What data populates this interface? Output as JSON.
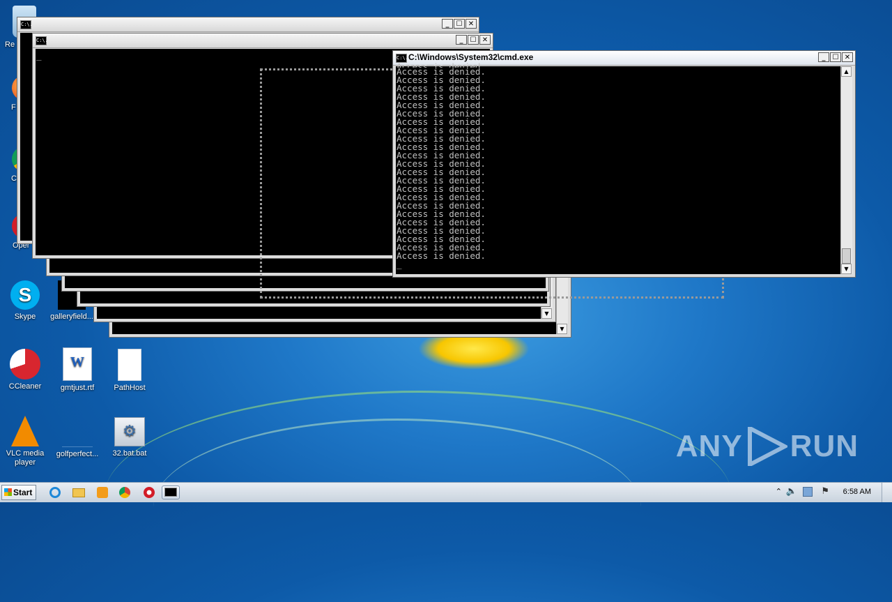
{
  "desktop": {
    "icons": [
      {
        "label": "Re"
      },
      {
        "label": "F"
      },
      {
        "label": "C"
      },
      {
        "label": "Oper"
      },
      {
        "label": "Skype"
      },
      {
        "label": "galleryfield..."
      },
      {
        "label": "CCleaner"
      },
      {
        "label": "gmtjust.rtf"
      },
      {
        "label": "PathHost"
      },
      {
        "label": "VLC media player"
      },
      {
        "label": "golfperfect..."
      },
      {
        "label": "32.bat.bat"
      }
    ]
  },
  "windows": {
    "front_title": "C:\\Windows\\System32\\cmd.exe",
    "console_icon": "C:\\.",
    "controls": {
      "minimize": "_",
      "maximize": "☐",
      "close": "✕"
    },
    "output_line": "Access is denied.",
    "output_partial": "Access is denied.",
    "cursor": "_"
  },
  "taskbar": {
    "start_label": "Start",
    "clock": "6:58 AM",
    "pinned": [
      "ie-icon",
      "explorer-icon",
      "media-player-icon",
      "chrome-icon",
      "opera-icon",
      "cmd-icon"
    ]
  },
  "watermark": {
    "text_left": "ANY",
    "text_right": "RUN"
  },
  "colors": {
    "console_bg": "#000000",
    "console_fg": "#c0c0c0",
    "desktop": "#1f78c8"
  }
}
